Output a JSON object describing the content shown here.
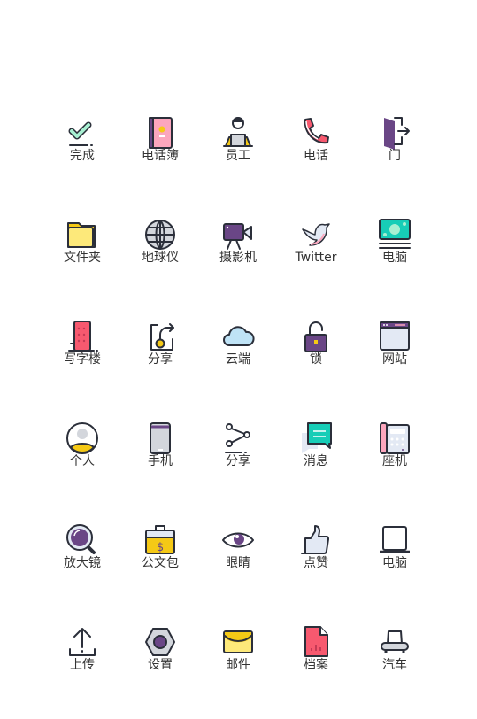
{
  "icons": [
    {
      "label": "完成",
      "icon": "checkmark-icon"
    },
    {
      "label": "电话簿",
      "icon": "phonebook-icon"
    },
    {
      "label": "员工",
      "icon": "employee-icon"
    },
    {
      "label": "电话",
      "icon": "phone-icon"
    },
    {
      "label": "门",
      "icon": "door-exit-icon"
    },
    {
      "label": "文件夹",
      "icon": "folder-icon"
    },
    {
      "label": "地球仪",
      "icon": "globe-icon"
    },
    {
      "label": "摄影机",
      "icon": "video-camera-icon"
    },
    {
      "label": "Twitter",
      "icon": "twitter-bird-icon"
    },
    {
      "label": "电脑",
      "icon": "money-icon"
    },
    {
      "label": "写字楼",
      "icon": "office-building-icon"
    },
    {
      "label": "分享",
      "icon": "share-export-icon"
    },
    {
      "label": "云端",
      "icon": "cloud-icon"
    },
    {
      "label": "锁",
      "icon": "padlock-icon"
    },
    {
      "label": "网站",
      "icon": "browser-window-icon"
    },
    {
      "label": "个人",
      "icon": "user-avatar-icon"
    },
    {
      "label": "手机",
      "icon": "mobile-phone-icon"
    },
    {
      "label": "分享",
      "icon": "share-nodes-icon"
    },
    {
      "label": "消息",
      "icon": "chat-message-icon"
    },
    {
      "label": "座机",
      "icon": "desk-phone-icon"
    },
    {
      "label": "放大镜",
      "icon": "magnifier-icon"
    },
    {
      "label": "公文包",
      "icon": "briefcase-icon"
    },
    {
      "label": "眼睛",
      "icon": "eye-icon"
    },
    {
      "label": "点赞",
      "icon": "thumbs-up-icon"
    },
    {
      "label": "电脑",
      "icon": "laptop-icon"
    },
    {
      "label": "上传",
      "icon": "upload-icon"
    },
    {
      "label": "设置",
      "icon": "settings-nut-icon"
    },
    {
      "label": "邮件",
      "icon": "mail-icon"
    },
    {
      "label": "档案",
      "icon": "file-chart-icon"
    },
    {
      "label": "汽车",
      "icon": "car-icon"
    }
  ],
  "colors": {
    "stroke": "#2b2f3a",
    "purple": "#6a4686",
    "pink": "#fca6bd",
    "red": "#f7596f",
    "yellow": "#f5c916",
    "lightyellow": "#fde97a",
    "teal": "#17cdb7",
    "mint": "#a8f0d2",
    "gray": "#d3d6dc",
    "lightblue": "#e3e9f4",
    "sky": "#bfe3f6"
  }
}
